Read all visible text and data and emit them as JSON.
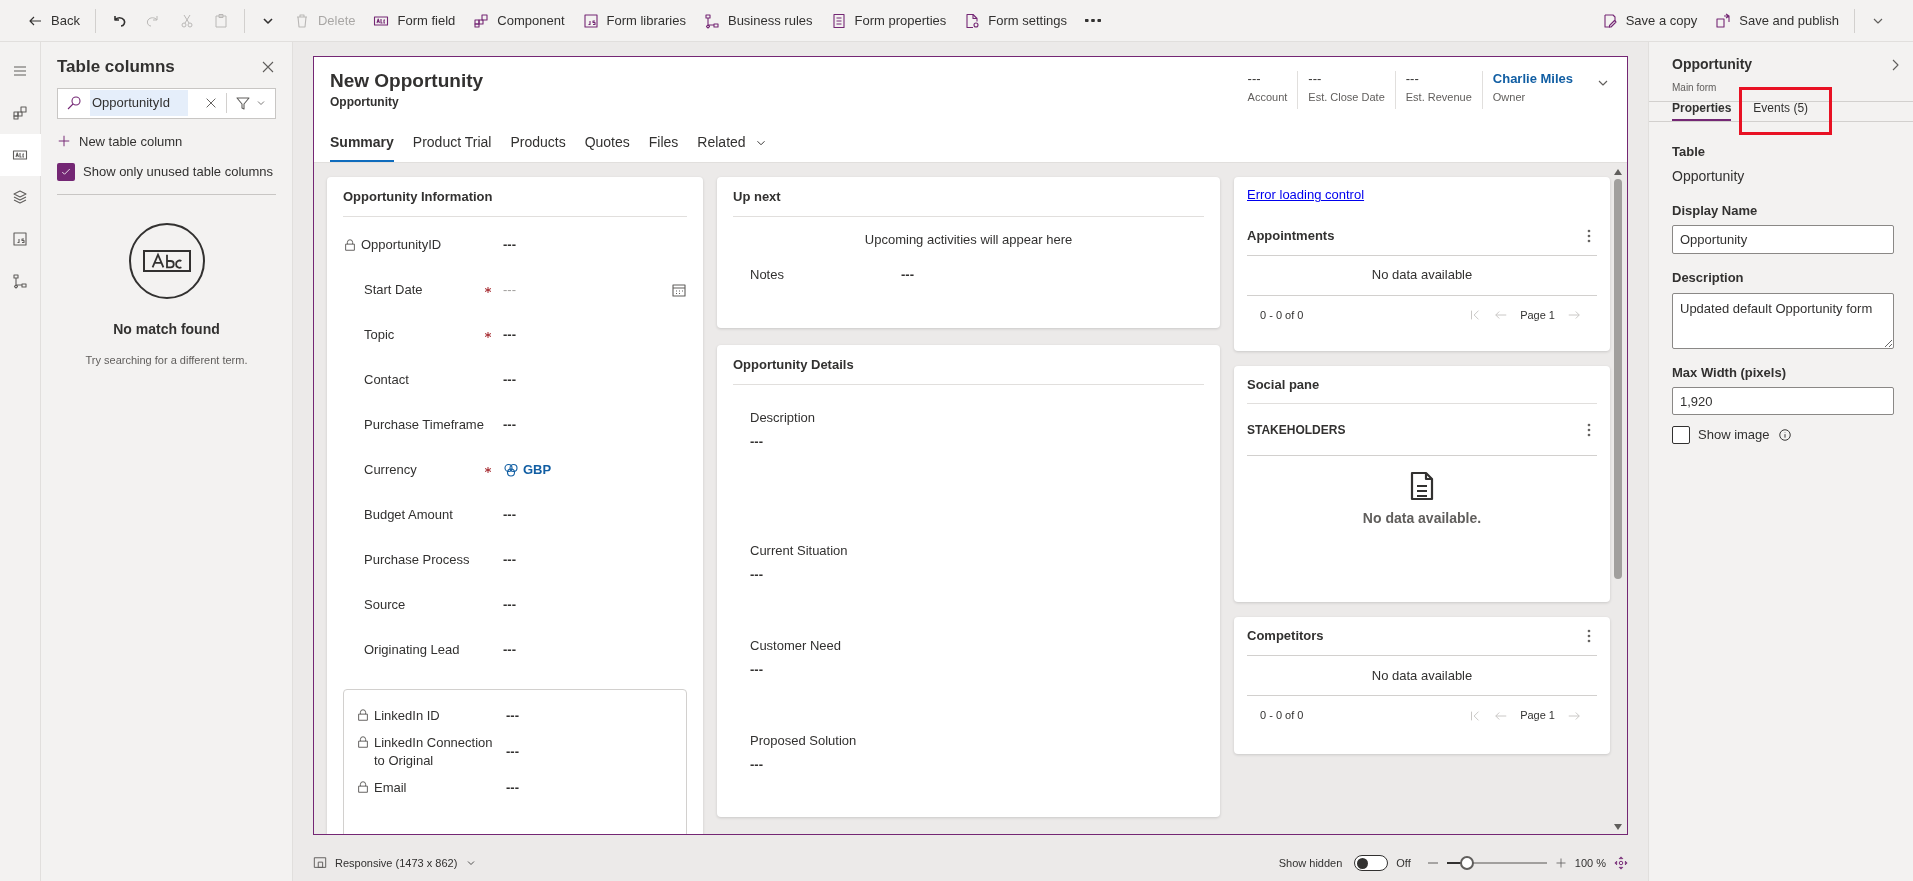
{
  "toolbar": {
    "items": [
      {
        "kind": "back",
        "label": "Back",
        "disabled": false
      },
      {
        "kind": "undo",
        "disabled": false
      },
      {
        "kind": "redo",
        "disabled": true
      },
      {
        "kind": "cut",
        "disabled": true
      },
      {
        "kind": "paste",
        "disabled": true
      },
      {
        "kind": "caret",
        "disabled": false
      },
      {
        "kind": "trash",
        "label": "Delete",
        "disabled": true
      },
      {
        "kind": "abc",
        "label": "Form field",
        "disabled": false
      },
      {
        "kind": "component",
        "label": "Component",
        "disabled": false
      },
      {
        "kind": "js",
        "label": "Form libraries",
        "disabled": false
      },
      {
        "kind": "tree",
        "label": "Business rules",
        "disabled": false
      },
      {
        "kind": "doclist",
        "label": "Form properties",
        "disabled": false
      },
      {
        "kind": "docgear",
        "label": "Form settings",
        "disabled": false
      },
      {
        "kind": "more",
        "disabled": false
      }
    ],
    "right_items": [
      {
        "kind": "savecopy",
        "label": "Save a copy"
      },
      {
        "kind": "publish",
        "label": "Save and publish"
      },
      {
        "kind": "caret"
      }
    ]
  },
  "nav_rail": {
    "items": [
      {
        "kind": "menu",
        "selected": false
      },
      {
        "kind": "component",
        "selected": false
      },
      {
        "kind": "abc",
        "selected": true
      },
      {
        "kind": "layers",
        "selected": false
      },
      {
        "kind": "js",
        "selected": false
      },
      {
        "kind": "tree",
        "selected": false
      }
    ]
  },
  "table_columns_panel": {
    "title": "Table columns",
    "search_value": "OpportunityId",
    "new_column": "New table column",
    "show_unused": {
      "label": "Show only unused table columns",
      "checked": true
    },
    "empty_title": "No match found",
    "empty_hint": "Try searching for a different term."
  },
  "form": {
    "title": "New Opportunity",
    "subtitle": "Opportunity",
    "header_fields": [
      {
        "value": "---",
        "label": "Account",
        "kind": "text"
      },
      {
        "value": "---",
        "label": "Est. Close Date",
        "kind": "text"
      },
      {
        "value": "---",
        "label": "Est. Revenue",
        "kind": "text"
      },
      {
        "value": "Charlie Miles",
        "label": "Owner",
        "kind": "link"
      }
    ],
    "tabs": [
      {
        "label": "Summary",
        "selected": true,
        "kind": "tab"
      },
      {
        "label": "Product Trial",
        "selected": false,
        "kind": "tab"
      },
      {
        "label": "Products",
        "selected": false,
        "kind": "tab"
      },
      {
        "label": "Quotes",
        "selected": false,
        "kind": "tab"
      },
      {
        "label": "Files",
        "selected": false,
        "kind": "tab"
      },
      {
        "label": "Related",
        "selected": false,
        "kind": "dropdown"
      }
    ],
    "opportunity_information": {
      "title": "Opportunity Information",
      "fields": [
        {
          "label": "OpportunityID",
          "value": "---",
          "locked": true,
          "required": false,
          "kind": "text"
        },
        {
          "label": "Start Date",
          "value": "---",
          "locked": false,
          "required": true,
          "kind": "date"
        },
        {
          "label": "Topic",
          "value": "---",
          "locked": false,
          "required": true,
          "kind": "text"
        },
        {
          "label": "Contact",
          "value": "---",
          "locked": false,
          "required": false,
          "kind": "text"
        },
        {
          "label": "Purchase Timeframe",
          "value": "---",
          "locked": false,
          "required": false,
          "kind": "text"
        },
        {
          "label": "Currency",
          "value": "GBP",
          "locked": false,
          "required": true,
          "kind": "lookup"
        },
        {
          "label": "Budget Amount",
          "value": "---",
          "locked": false,
          "required": false,
          "kind": "text"
        },
        {
          "label": "Purchase Process",
          "value": "---",
          "locked": false,
          "required": false,
          "kind": "text"
        },
        {
          "label": "Source",
          "value": "---",
          "locked": false,
          "required": false,
          "kind": "text"
        },
        {
          "label": "Originating Lead",
          "value": "---",
          "locked": false,
          "required": false,
          "kind": "text"
        }
      ],
      "sub_fields": [
        {
          "label": "LinkedIn ID",
          "value": "---",
          "locked": true
        },
        {
          "label": "LinkedIn Connection to Original",
          "value": "---",
          "locked": true
        },
        {
          "label": "Email",
          "value": "---",
          "locked": true
        }
      ]
    },
    "up_next": {
      "title": "Up next",
      "message": "Upcoming activities will appear here",
      "notes_label": "Notes",
      "notes_value": "---"
    },
    "opportunity_details": {
      "title": "Opportunity Details",
      "fields": [
        {
          "label": "Description",
          "value": "---"
        },
        {
          "label": "Current Situation",
          "value": "---"
        },
        {
          "label": "Customer Need",
          "value": "---"
        },
        {
          "label": "Proposed Solution",
          "value": "---"
        }
      ]
    },
    "error_link": "Error loading control",
    "appointments": {
      "title": "Appointments",
      "empty": "No data available",
      "range": "0 - 0 of 0",
      "page": "Page 1"
    },
    "social_pane": {
      "title": "Social pane",
      "section": "STAKEHOLDERS",
      "empty": "No data available."
    },
    "competitors": {
      "title": "Competitors",
      "empty": "No data available",
      "range": "0 - 0 of 0",
      "page": "Page 1"
    }
  },
  "properties_panel": {
    "title": "Opportunity",
    "subtitle": "Main form",
    "tabs": [
      {
        "label": "Properties",
        "selected": true,
        "highlighted": false
      },
      {
        "label": "Events (5)",
        "selected": false,
        "highlighted": true
      }
    ],
    "table_label": "Table",
    "table_value": "Opportunity",
    "display_name_label": "Display Name",
    "display_name_value": "Opportunity",
    "description_label": "Description",
    "description_value": "Updated default Opportunity form",
    "max_width_label": "Max Width (pixels)",
    "max_width_value": "1,920",
    "show_image": {
      "label": "Show image",
      "checked": false
    }
  },
  "status_bar": {
    "layout": "Responsive (1473 x 862)",
    "show_hidden_label": "Show hidden",
    "show_hidden": {
      "on": false,
      "label": "Off"
    },
    "zoom": {
      "level": 0.2,
      "label": "100 %"
    }
  }
}
